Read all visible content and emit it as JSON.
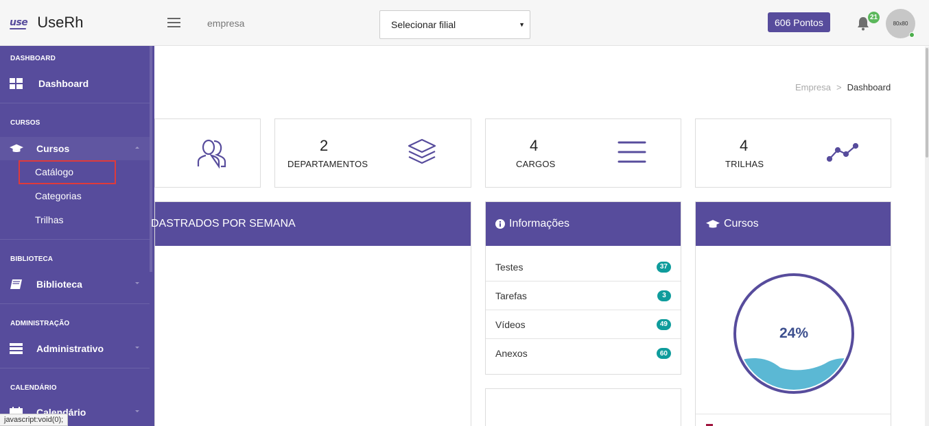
{
  "header": {
    "logo_mark": "use",
    "app_name": "UseRh",
    "company_label": "empresa",
    "branch_select": {
      "value": "Selecionar filial"
    },
    "points": "606 Pontos",
    "notification_count": "21",
    "avatar_text": "80x80"
  },
  "sidebar": {
    "sections": [
      {
        "title": "DASHBOARD",
        "item": "Dashboard"
      },
      {
        "title": "CURSOS",
        "item": "Cursos",
        "subitems": [
          "Catálogo",
          "Categorias",
          "Trilhas"
        ]
      },
      {
        "title": "BIBLIOTECA",
        "item": "Biblioteca"
      },
      {
        "title": "ADMINISTRAÇÃO",
        "item": "Administrativo"
      },
      {
        "title": "CALENDÁRIO",
        "item": "Calendário"
      }
    ]
  },
  "breadcrumb": {
    "root": "Empresa",
    "separator": ">",
    "current": "Dashboard"
  },
  "stats": [
    {
      "value": "2",
      "label": "DEPARTAMENTOS"
    },
    {
      "value": "4",
      "label": "CARGOS"
    },
    {
      "value": "4",
      "label": "TRILHAS"
    }
  ],
  "panels": {
    "weekly_title": "DASTRADOS POR SEMANA",
    "info_title": "Informações",
    "info_rows": [
      {
        "label": "Testes",
        "count": "37"
      },
      {
        "label": "Tarefas",
        "count": "3"
      },
      {
        "label": "Vídeos",
        "count": "49"
      },
      {
        "label": "Anexos",
        "count": "60"
      }
    ],
    "courses_title": "Cursos",
    "courses_progress": {
      "text": "24%",
      "value": 0.24
    }
  },
  "status_bar": "javascript:void(0);",
  "colors": {
    "primary": "#574c9c",
    "badge": "#0f9c9c",
    "wave": "#5bb8d4",
    "highlight": "#e03a3a"
  }
}
